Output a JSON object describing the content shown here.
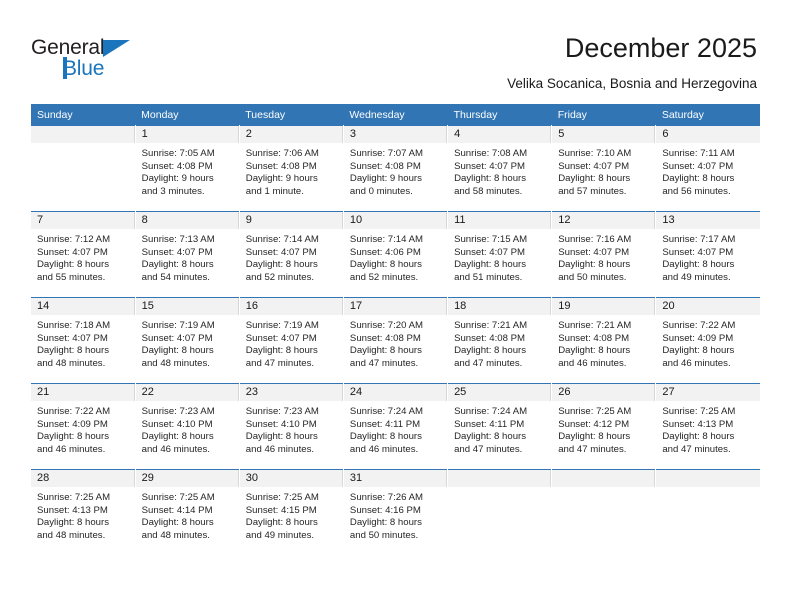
{
  "brand": {
    "name_top": "General",
    "name_bottom": "Blue",
    "accent_color": "#1b75bc"
  },
  "header": {
    "title": "December 2025",
    "subtitle": "Velika Socanica, Bosnia and Herzegovina"
  },
  "theme": {
    "header_blue": "#3175b4",
    "daynum_band": "#f2f2f2",
    "text": "#262626"
  },
  "calendar": {
    "weekday_headers": [
      "Sunday",
      "Monday",
      "Tuesday",
      "Wednesday",
      "Thursday",
      "Friday",
      "Saturday"
    ],
    "weeks": [
      [
        {
          "day": "",
          "sunrise": "",
          "sunset": "",
          "daylight_1": "",
          "daylight_2": ""
        },
        {
          "day": "1",
          "sunrise": "Sunrise: 7:05 AM",
          "sunset": "Sunset: 4:08 PM",
          "daylight_1": "Daylight: 9 hours",
          "daylight_2": "and 3 minutes."
        },
        {
          "day": "2",
          "sunrise": "Sunrise: 7:06 AM",
          "sunset": "Sunset: 4:08 PM",
          "daylight_1": "Daylight: 9 hours",
          "daylight_2": "and 1 minute."
        },
        {
          "day": "3",
          "sunrise": "Sunrise: 7:07 AM",
          "sunset": "Sunset: 4:08 PM",
          "daylight_1": "Daylight: 9 hours",
          "daylight_2": "and 0 minutes."
        },
        {
          "day": "4",
          "sunrise": "Sunrise: 7:08 AM",
          "sunset": "Sunset: 4:07 PM",
          "daylight_1": "Daylight: 8 hours",
          "daylight_2": "and 58 minutes."
        },
        {
          "day": "5",
          "sunrise": "Sunrise: 7:10 AM",
          "sunset": "Sunset: 4:07 PM",
          "daylight_1": "Daylight: 8 hours",
          "daylight_2": "and 57 minutes."
        },
        {
          "day": "6",
          "sunrise": "Sunrise: 7:11 AM",
          "sunset": "Sunset: 4:07 PM",
          "daylight_1": "Daylight: 8 hours",
          "daylight_2": "and 56 minutes."
        }
      ],
      [
        {
          "day": "7",
          "sunrise": "Sunrise: 7:12 AM",
          "sunset": "Sunset: 4:07 PM",
          "daylight_1": "Daylight: 8 hours",
          "daylight_2": "and 55 minutes."
        },
        {
          "day": "8",
          "sunrise": "Sunrise: 7:13 AM",
          "sunset": "Sunset: 4:07 PM",
          "daylight_1": "Daylight: 8 hours",
          "daylight_2": "and 54 minutes."
        },
        {
          "day": "9",
          "sunrise": "Sunrise: 7:14 AM",
          "sunset": "Sunset: 4:07 PM",
          "daylight_1": "Daylight: 8 hours",
          "daylight_2": "and 52 minutes."
        },
        {
          "day": "10",
          "sunrise": "Sunrise: 7:14 AM",
          "sunset": "Sunset: 4:06 PM",
          "daylight_1": "Daylight: 8 hours",
          "daylight_2": "and 52 minutes."
        },
        {
          "day": "11",
          "sunrise": "Sunrise: 7:15 AM",
          "sunset": "Sunset: 4:07 PM",
          "daylight_1": "Daylight: 8 hours",
          "daylight_2": "and 51 minutes."
        },
        {
          "day": "12",
          "sunrise": "Sunrise: 7:16 AM",
          "sunset": "Sunset: 4:07 PM",
          "daylight_1": "Daylight: 8 hours",
          "daylight_2": "and 50 minutes."
        },
        {
          "day": "13",
          "sunrise": "Sunrise: 7:17 AM",
          "sunset": "Sunset: 4:07 PM",
          "daylight_1": "Daylight: 8 hours",
          "daylight_2": "and 49 minutes."
        }
      ],
      [
        {
          "day": "14",
          "sunrise": "Sunrise: 7:18 AM",
          "sunset": "Sunset: 4:07 PM",
          "daylight_1": "Daylight: 8 hours",
          "daylight_2": "and 48 minutes."
        },
        {
          "day": "15",
          "sunrise": "Sunrise: 7:19 AM",
          "sunset": "Sunset: 4:07 PM",
          "daylight_1": "Daylight: 8 hours",
          "daylight_2": "and 48 minutes."
        },
        {
          "day": "16",
          "sunrise": "Sunrise: 7:19 AM",
          "sunset": "Sunset: 4:07 PM",
          "daylight_1": "Daylight: 8 hours",
          "daylight_2": "and 47 minutes."
        },
        {
          "day": "17",
          "sunrise": "Sunrise: 7:20 AM",
          "sunset": "Sunset: 4:08 PM",
          "daylight_1": "Daylight: 8 hours",
          "daylight_2": "and 47 minutes."
        },
        {
          "day": "18",
          "sunrise": "Sunrise: 7:21 AM",
          "sunset": "Sunset: 4:08 PM",
          "daylight_1": "Daylight: 8 hours",
          "daylight_2": "and 47 minutes."
        },
        {
          "day": "19",
          "sunrise": "Sunrise: 7:21 AM",
          "sunset": "Sunset: 4:08 PM",
          "daylight_1": "Daylight: 8 hours",
          "daylight_2": "and 46 minutes."
        },
        {
          "day": "20",
          "sunrise": "Sunrise: 7:22 AM",
          "sunset": "Sunset: 4:09 PM",
          "daylight_1": "Daylight: 8 hours",
          "daylight_2": "and 46 minutes."
        }
      ],
      [
        {
          "day": "21",
          "sunrise": "Sunrise: 7:22 AM",
          "sunset": "Sunset: 4:09 PM",
          "daylight_1": "Daylight: 8 hours",
          "daylight_2": "and 46 minutes."
        },
        {
          "day": "22",
          "sunrise": "Sunrise: 7:23 AM",
          "sunset": "Sunset: 4:10 PM",
          "daylight_1": "Daylight: 8 hours",
          "daylight_2": "and 46 minutes."
        },
        {
          "day": "23",
          "sunrise": "Sunrise: 7:23 AM",
          "sunset": "Sunset: 4:10 PM",
          "daylight_1": "Daylight: 8 hours",
          "daylight_2": "and 46 minutes."
        },
        {
          "day": "24",
          "sunrise": "Sunrise: 7:24 AM",
          "sunset": "Sunset: 4:11 PM",
          "daylight_1": "Daylight: 8 hours",
          "daylight_2": "and 46 minutes."
        },
        {
          "day": "25",
          "sunrise": "Sunrise: 7:24 AM",
          "sunset": "Sunset: 4:11 PM",
          "daylight_1": "Daylight: 8 hours",
          "daylight_2": "and 47 minutes."
        },
        {
          "day": "26",
          "sunrise": "Sunrise: 7:25 AM",
          "sunset": "Sunset: 4:12 PM",
          "daylight_1": "Daylight: 8 hours",
          "daylight_2": "and 47 minutes."
        },
        {
          "day": "27",
          "sunrise": "Sunrise: 7:25 AM",
          "sunset": "Sunset: 4:13 PM",
          "daylight_1": "Daylight: 8 hours",
          "daylight_2": "and 47 minutes."
        }
      ],
      [
        {
          "day": "28",
          "sunrise": "Sunrise: 7:25 AM",
          "sunset": "Sunset: 4:13 PM",
          "daylight_1": "Daylight: 8 hours",
          "daylight_2": "and 48 minutes."
        },
        {
          "day": "29",
          "sunrise": "Sunrise: 7:25 AM",
          "sunset": "Sunset: 4:14 PM",
          "daylight_1": "Daylight: 8 hours",
          "daylight_2": "and 48 minutes."
        },
        {
          "day": "30",
          "sunrise": "Sunrise: 7:25 AM",
          "sunset": "Sunset: 4:15 PM",
          "daylight_1": "Daylight: 8 hours",
          "daylight_2": "and 49 minutes."
        },
        {
          "day": "31",
          "sunrise": "Sunrise: 7:26 AM",
          "sunset": "Sunset: 4:16 PM",
          "daylight_1": "Daylight: 8 hours",
          "daylight_2": "and 50 minutes."
        },
        {
          "day": "",
          "sunrise": "",
          "sunset": "",
          "daylight_1": "",
          "daylight_2": ""
        },
        {
          "day": "",
          "sunrise": "",
          "sunset": "",
          "daylight_1": "",
          "daylight_2": ""
        },
        {
          "day": "",
          "sunrise": "",
          "sunset": "",
          "daylight_1": "",
          "daylight_2": ""
        }
      ]
    ]
  }
}
